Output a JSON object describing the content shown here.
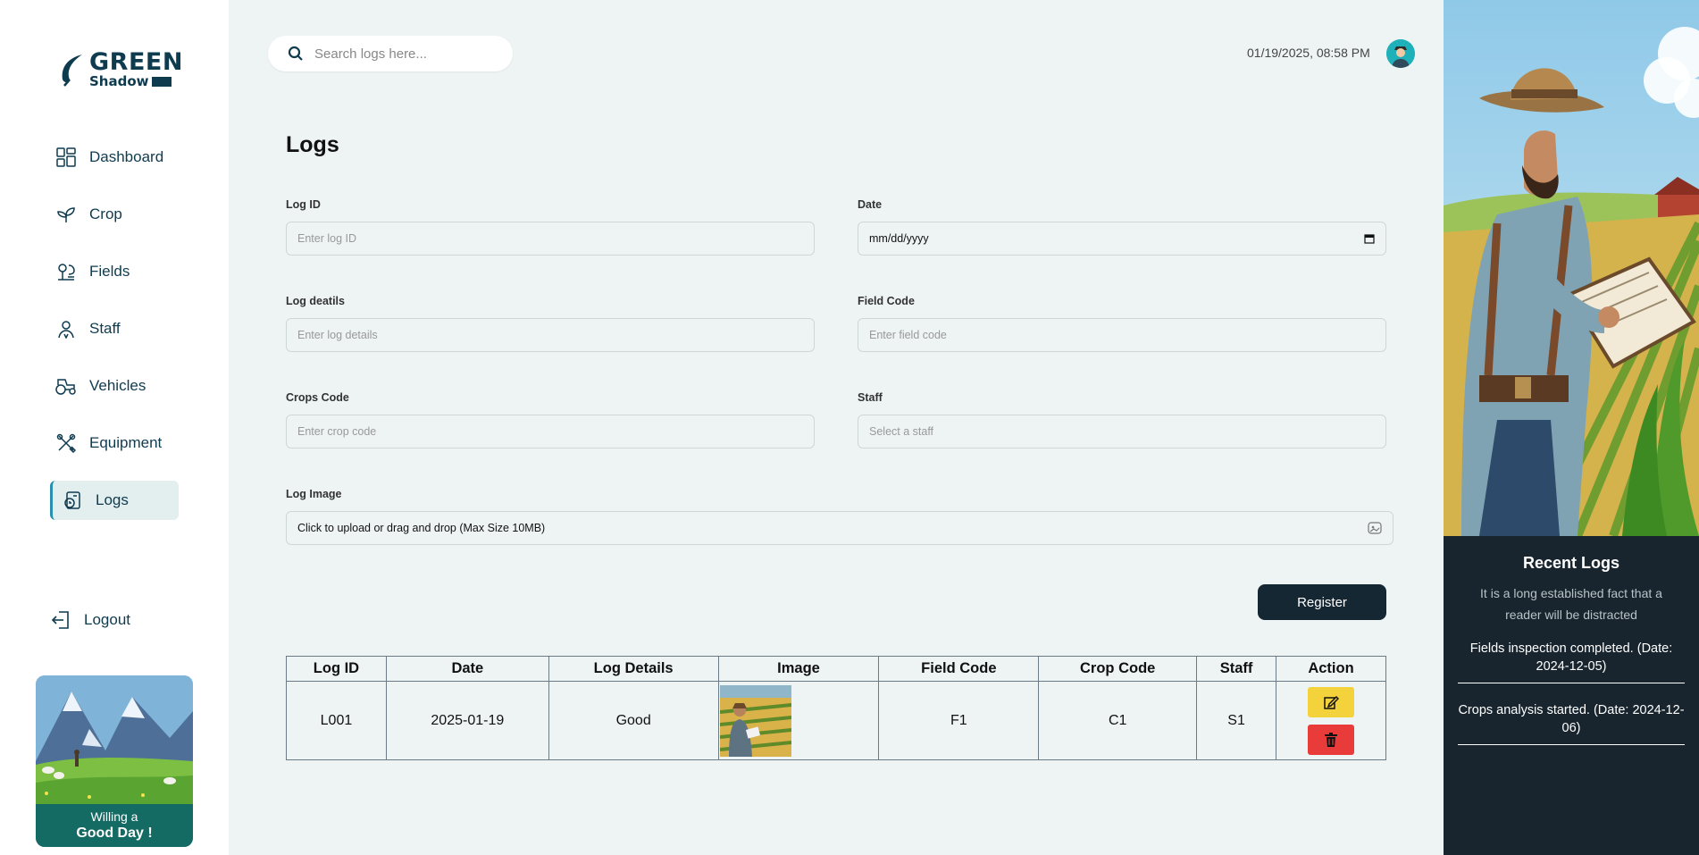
{
  "brand": {
    "name_top": "GREEN",
    "name_bottom": "Shadow"
  },
  "sidebar": {
    "items": [
      {
        "label": "Dashboard",
        "icon": "dashboard-icon"
      },
      {
        "label": "Crop",
        "icon": "sprout-icon"
      },
      {
        "label": "Fields",
        "icon": "field-icon"
      },
      {
        "label": "Staff",
        "icon": "staff-icon"
      },
      {
        "label": "Vehicles",
        "icon": "tractor-icon"
      },
      {
        "label": "Equipment",
        "icon": "tools-icon"
      },
      {
        "label": "Logs",
        "icon": "logs-icon",
        "active": true
      }
    ],
    "logout_label": "Logout",
    "promo": {
      "line1": "Willing a",
      "line2": "Good Day !"
    }
  },
  "header": {
    "search_placeholder": "Search logs here...",
    "datetime": "01/19/2025, 08:58 PM"
  },
  "page": {
    "title": "Logs"
  },
  "form": {
    "log_id": {
      "label": "Log ID",
      "placeholder": "Enter log ID"
    },
    "date": {
      "label": "Date",
      "value": "mm/dd/yyyy"
    },
    "log_details": {
      "label": "Log deatils",
      "placeholder": "Enter log details"
    },
    "field_code": {
      "label": "Field Code",
      "placeholder": "Enter field code"
    },
    "crops_code": {
      "label": "Crops Code",
      "placeholder": "Enter crop code"
    },
    "staff": {
      "label": "Staff",
      "placeholder": "Select a staff"
    },
    "log_image": {
      "label": "Log Image",
      "hint": "Click to upload or drag and drop (Max Size 10MB)"
    },
    "register_label": "Register"
  },
  "table": {
    "headers": [
      "Log ID",
      "Date",
      "Log Details",
      "Image",
      "Field Code",
      "Crop Code",
      "Staff",
      "Action"
    ],
    "rows": [
      {
        "log_id": "L001",
        "date": "2025-01-19",
        "details": "Good",
        "field_code": "F1",
        "crop_code": "C1",
        "staff": "S1"
      }
    ]
  },
  "recent": {
    "title": "Recent Logs",
    "subtitle": "It is a long established fact that a reader will be distracted",
    "items": [
      "Fields inspection completed. (Date: 2024-12-05)",
      "Crops analysis started. (Date: 2024-12-06)"
    ]
  },
  "colors": {
    "brand": "#0f3b4f",
    "accent": "#2a8fb0",
    "register": "#162734",
    "edit": "#f4d23b",
    "delete": "#ea3b3b",
    "panel": "#18252e"
  }
}
